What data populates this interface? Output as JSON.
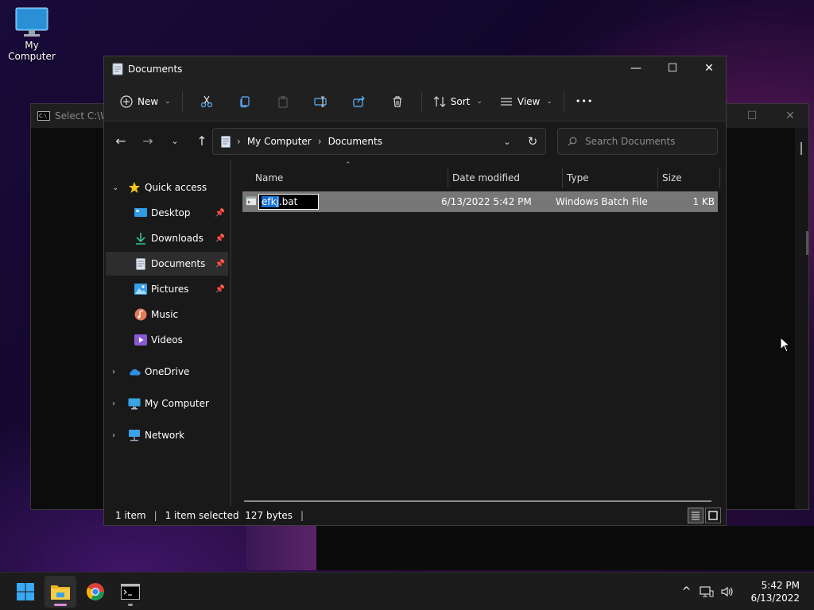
{
  "desktop": {
    "icons": [
      {
        "label": "My Computer",
        "icon": "monitor-icon"
      }
    ]
  },
  "background_window": {
    "title": "Select C:\\W"
  },
  "explorer": {
    "title": "Documents",
    "window_controls": {
      "minimize": "—",
      "maximize": "☐",
      "close": "✕"
    },
    "toolbar": {
      "new_label": "New",
      "sort_label": "Sort",
      "view_label": "View",
      "more_label": "•••"
    },
    "address": {
      "segments": [
        "My Computer",
        "Documents"
      ],
      "separator": "›"
    },
    "search": {
      "placeholder": "Search Documents"
    },
    "sidebar": {
      "quick_access": "Quick access",
      "pinned": [
        {
          "label": "Desktop",
          "pinned": true
        },
        {
          "label": "Downloads",
          "pinned": true
        },
        {
          "label": "Documents",
          "pinned": true,
          "selected": true
        },
        {
          "label": "Pictures",
          "pinned": true
        },
        {
          "label": "Music",
          "pinned": false
        },
        {
          "label": "Videos",
          "pinned": false
        }
      ],
      "onedrive": "OneDrive",
      "my_computer": "My Computer",
      "network": "Network"
    },
    "columns": {
      "name": "Name",
      "date_modified": "Date modified",
      "type": "Type",
      "size": "Size"
    },
    "files": [
      {
        "name_selected_part": "efkj",
        "name_rest": ".bat",
        "date_modified": "6/13/2022 5:42 PM",
        "type": "Windows Batch File",
        "size": "1 KB",
        "renaming": true
      }
    ],
    "status": {
      "item_count": "1 item",
      "selection": "1 item selected  127 bytes",
      "separator": "|"
    }
  },
  "taskbar": {
    "clock_time": "5:42 PM",
    "clock_date": "6/13/2022"
  },
  "colors": {
    "accent": "#0a84ff",
    "selection_row": "#777777",
    "rename_highlight": "#1670d4"
  }
}
